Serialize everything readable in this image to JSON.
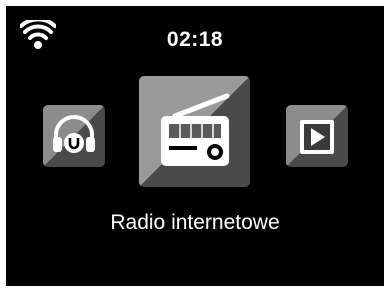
{
  "status_bar": {
    "wifi_icon": "wifi-icon",
    "time": "02:18"
  },
  "menu": {
    "items": [
      {
        "id": "upnp",
        "icon": "upnp-headphones-icon",
        "selected": false
      },
      {
        "id": "internet-radio",
        "icon": "radio-icon",
        "selected": true
      },
      {
        "id": "media-player",
        "icon": "play-icon",
        "selected": false
      }
    ],
    "selected_label": "Radio internetowe"
  },
  "colors": {
    "background": "#000000",
    "tile_light": "#9a9a9a",
    "tile_dark": "#4a4a4a",
    "text": "#ffffff"
  }
}
